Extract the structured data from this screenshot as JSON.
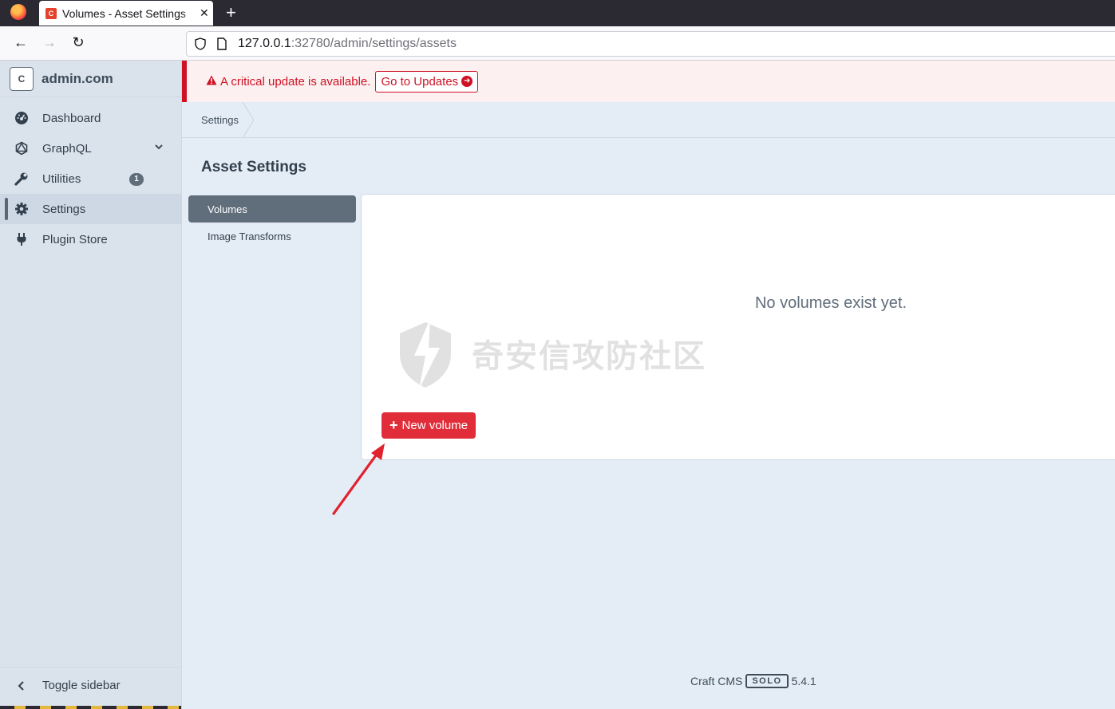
{
  "browser": {
    "tab_title": "Volumes - Asset Settings",
    "tab_favicon_letter": "C",
    "url_host": "127.0.0.1",
    "url_path": ":32780/admin/settings/assets"
  },
  "sidebar": {
    "site_icon": "C",
    "site_name": "admin.com",
    "items": [
      {
        "label": "Dashboard",
        "icon": "dashboard-gauge-icon"
      },
      {
        "label": "GraphQL",
        "icon": "graphql-icon"
      },
      {
        "label": "Utilities",
        "icon": "wrench-icon",
        "badge": "1"
      },
      {
        "label": "Settings",
        "icon": "gear-icon"
      },
      {
        "label": "Plugin Store",
        "icon": "plug-icon"
      }
    ],
    "toggle_label": "Toggle sidebar"
  },
  "alert": {
    "message": "A critical update is available.",
    "button_label": "Go to Updates"
  },
  "breadcrumb": {
    "item": "Settings"
  },
  "page": {
    "title": "Asset Settings",
    "subnav": [
      "Volumes",
      "Image Transforms"
    ],
    "empty_message": "No volumes exist yet.",
    "new_button": "New volume"
  },
  "watermark": "奇安信攻防社区",
  "footer": {
    "product": "Craft CMS",
    "edition": "SOLO",
    "version": "5.4.1"
  },
  "colors": {
    "accent": "#e12d39",
    "alert": "#cf1124",
    "sidebar": "#dae3ec",
    "background": "#e4edf6"
  }
}
